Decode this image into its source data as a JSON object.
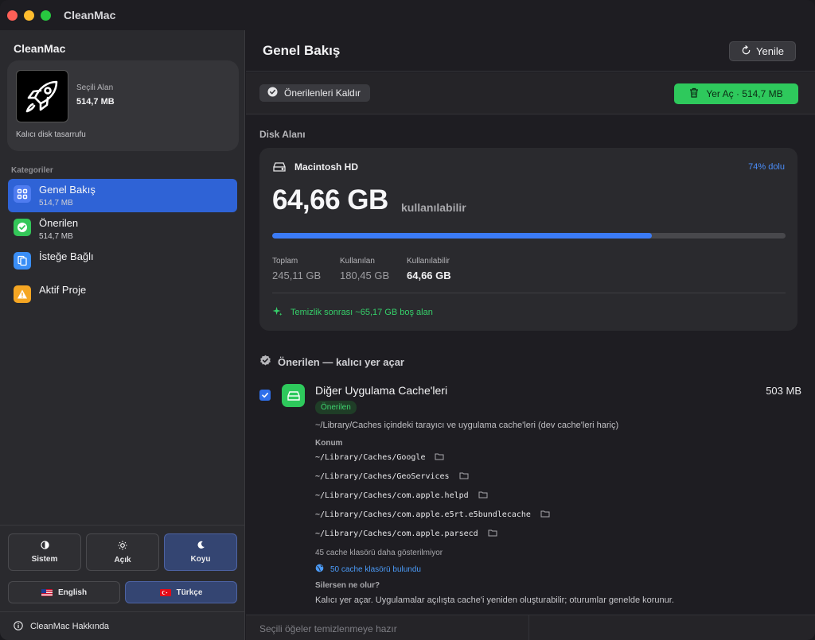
{
  "app": {
    "title": "CleanMac"
  },
  "sidebar": {
    "title": "CleanMac",
    "selection": {
      "label": "Seçili Alan",
      "value": "514,7 MB",
      "note": "Kalıcı disk tasarrufu"
    },
    "categories_label": "Kategoriler",
    "items": [
      {
        "name": "Genel Bakış",
        "sub": "514,7 MB",
        "icon": "grid-icon",
        "color": "#4f7cf0"
      },
      {
        "name": "Önerilen",
        "sub": "514,7 MB",
        "icon": "check-badge-icon",
        "color": "#34c759"
      },
      {
        "name": "İsteğe Bağlı",
        "sub": "",
        "icon": "documents-icon",
        "color": "#3a8ef6"
      },
      {
        "name": "Aktif Proje",
        "sub": "",
        "icon": "warning-icon",
        "color": "#f5a623"
      }
    ],
    "themes": [
      {
        "label": "Sistem",
        "icon": "half-circle-icon"
      },
      {
        "label": "Açık",
        "icon": "sun-icon"
      },
      {
        "label": "Koyu",
        "icon": "moon-icon"
      }
    ],
    "languages": [
      {
        "label": "English",
        "flag": "us-flag-icon"
      },
      {
        "label": "Türkçe",
        "flag": "tr-flag-icon"
      }
    ],
    "about": "CleanMac Hakkında"
  },
  "header": {
    "title": "Genel Bakış",
    "refresh": "Yenile"
  },
  "actions": {
    "remove_recommended": "Önerilenleri Kaldır",
    "free_space": "Yer Aç · 514,7 MB"
  },
  "disk": {
    "section_title": "Disk Alanı",
    "name": "Macintosh HD",
    "percent_label": "74% dolu",
    "used_fraction": 0.74,
    "available_big": "64,66 GB",
    "available_suffix": "kullanılabilir",
    "stats": [
      {
        "label": "Toplam",
        "value": "245,11 GB"
      },
      {
        "label": "Kullanılan",
        "value": "180,45 GB"
      },
      {
        "label": "Kullanılabilir",
        "value": "64,66 GB"
      }
    ],
    "after_clean": "Temizlik sonrası ~65,17 GB boş alan"
  },
  "recommended": {
    "title": "Önerilen — kalıcı yer açar",
    "item": {
      "title": "Diğer Uygulama Cache'leri",
      "size": "503 MB",
      "badge": "Önerilen",
      "description": "~/Library/Caches içindeki tarayıcı ve uygulama cache'leri (dev cache'leri hariç)",
      "location_label": "Konum",
      "paths": [
        "~/Library/Caches/Google",
        "~/Library/Caches/GeoServices",
        "~/Library/Caches/com.apple.helpd",
        "~/Library/Caches/com.apple.e5rt.e5bundlecache",
        "~/Library/Caches/com.apple.parsecd"
      ],
      "hidden_note": "45 cache klasörü daha gösterilmiyor",
      "found_link": "50 cache klasörü bulundu",
      "what_label": "Silersen ne olur?",
      "what_text": "Kalıcı yer açar. Uygulamalar açılışta cache'i yeniden oluşturabilir; oturumlar genelde korunur."
    }
  },
  "footer": {
    "status": "Seçili öğeler temizlenmeye hazır"
  }
}
